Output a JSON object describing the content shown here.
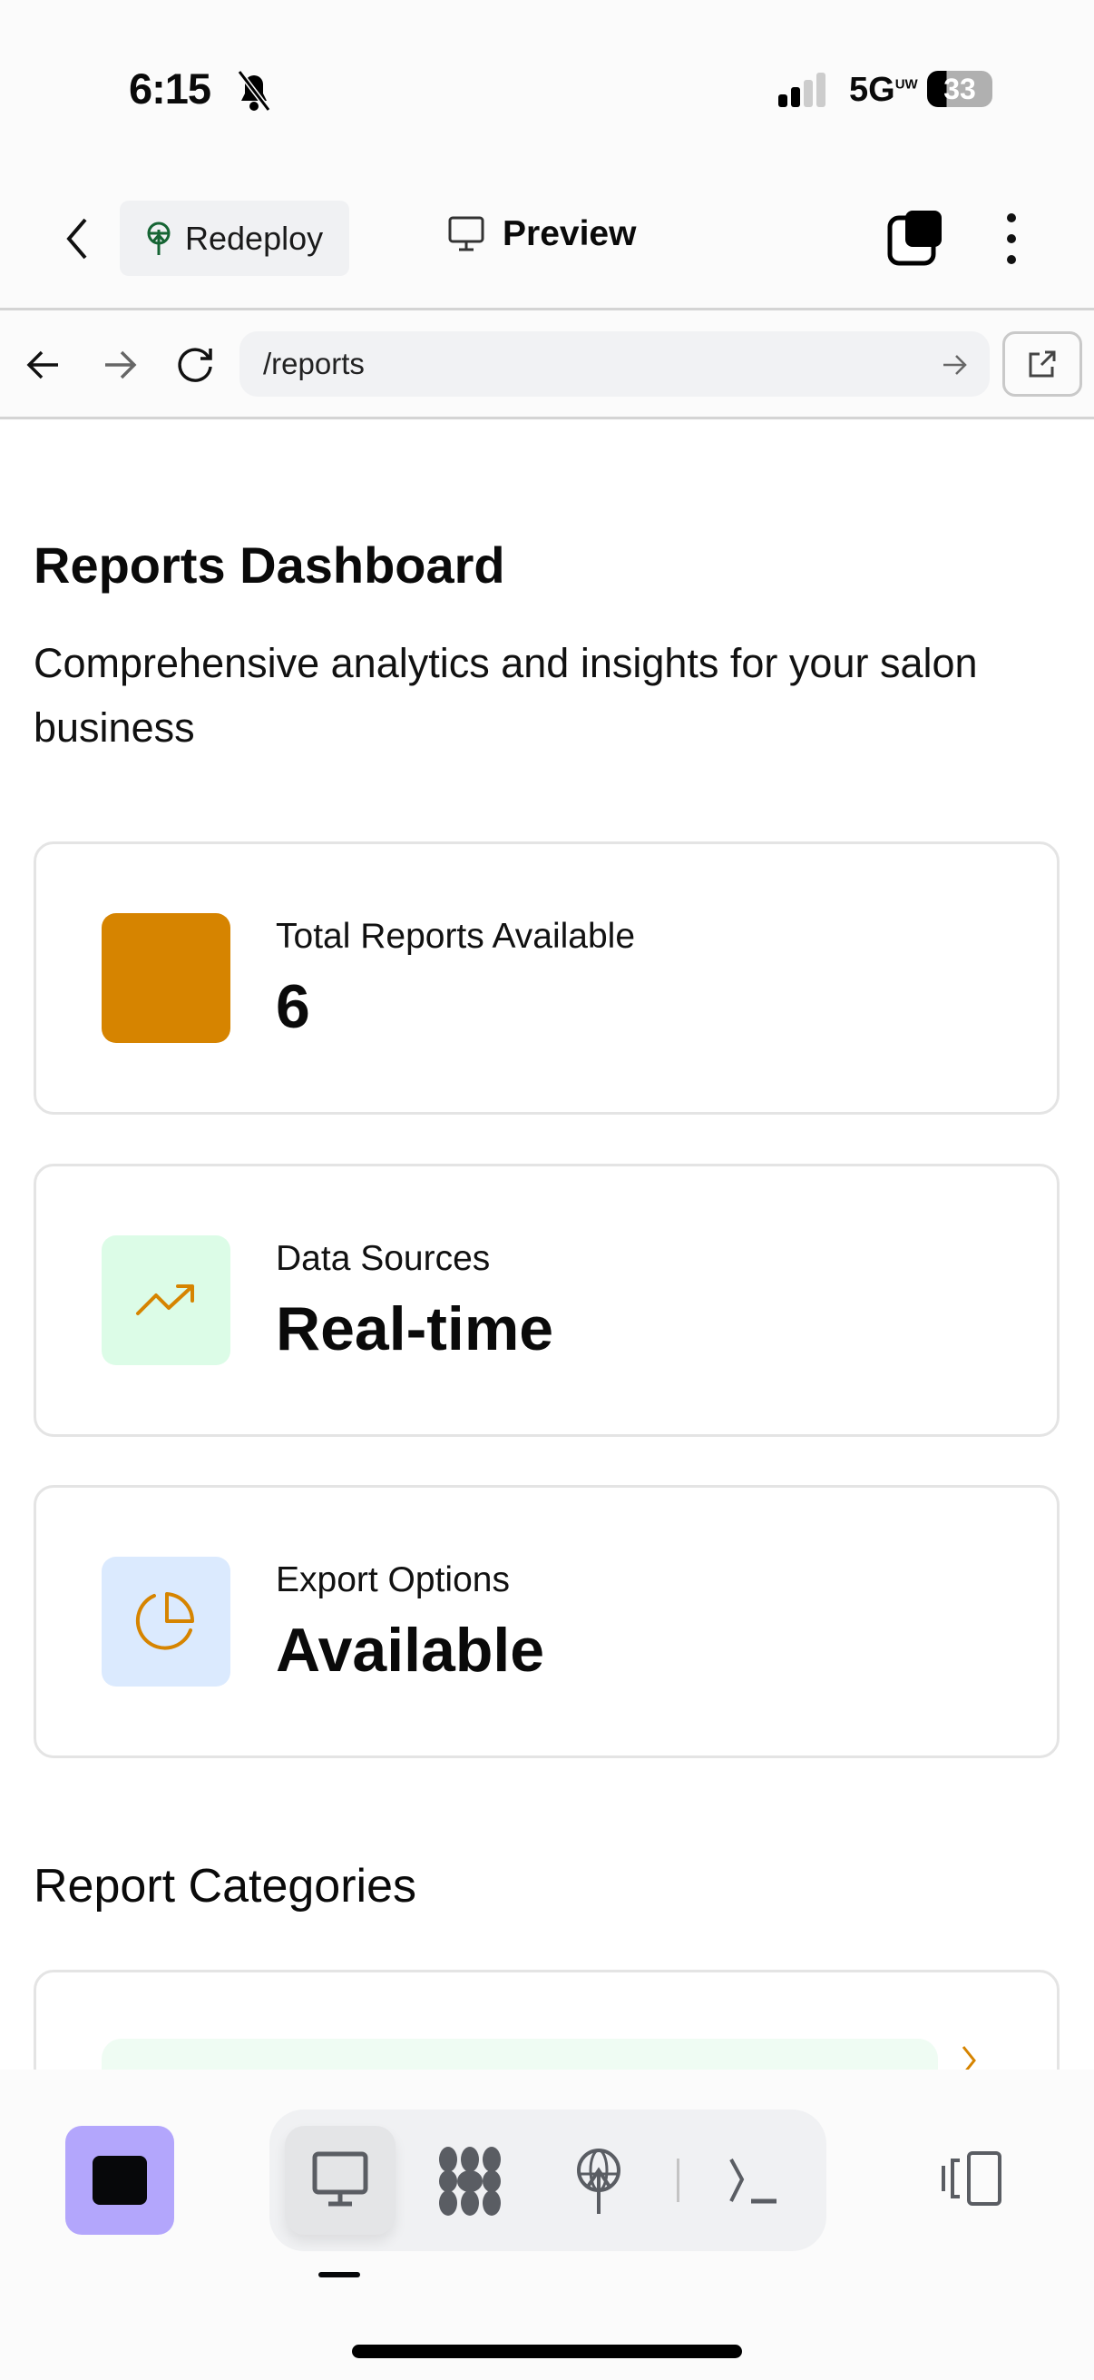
{
  "status_bar": {
    "time": "6:15",
    "network": "5G",
    "network_sup": "UW",
    "battery": "33"
  },
  "top_bar": {
    "redeploy_label": "Redeploy",
    "preview_label": "Preview"
  },
  "browser": {
    "url": "/reports"
  },
  "page": {
    "title": "Reports Dashboard",
    "subtitle": "Comprehensive analytics and insights for your salon business",
    "stats": [
      {
        "label": "Total Reports Available",
        "value": "6",
        "icon": "square",
        "icon_bg": "#d68400"
      },
      {
        "label": "Data Sources",
        "value": "Real-time",
        "icon": "trending-up-icon",
        "icon_bg": "#dcfce7"
      },
      {
        "label": "Export Options",
        "value": "Available",
        "icon": "pie-chart-icon",
        "icon_bg": "#dbeafe"
      }
    ],
    "section_title": "Report Categories"
  },
  "colors": {
    "accent": "#d68400",
    "purple": "#b3a6fc"
  }
}
